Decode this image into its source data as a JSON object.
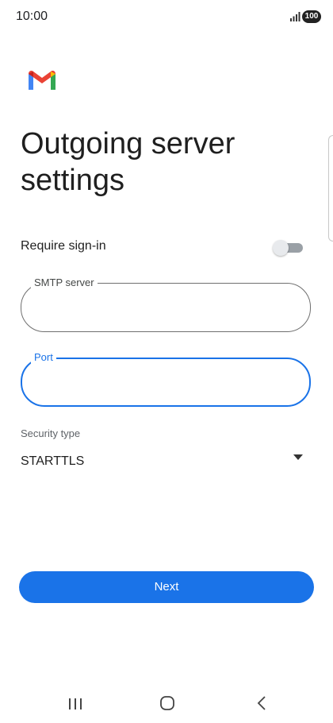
{
  "status_bar": {
    "time": "10:00",
    "battery": "100",
    "icons": [
      "signal-icon",
      "battery-icon"
    ]
  },
  "app": {
    "logo": "gmail-logo",
    "colors": {
      "accent": "#1a73e8",
      "logo_red": "#ea4335",
      "logo_blue": "#4285f4",
      "logo_green": "#34a853",
      "logo_yellow": "#fbbc04"
    }
  },
  "page": {
    "title": "Outgoing server settings"
  },
  "require_signin": {
    "label": "Require sign-in",
    "enabled": false
  },
  "smtp_server": {
    "label": "SMTP server",
    "value": ""
  },
  "port": {
    "label": "Port",
    "value": "",
    "focused": true
  },
  "security_type": {
    "label": "Security type",
    "value": "STARTTLS"
  },
  "next_button": {
    "label": "Next"
  },
  "nav_bar": {
    "icons": [
      "recent-apps-icon",
      "home-icon",
      "back-icon"
    ]
  }
}
